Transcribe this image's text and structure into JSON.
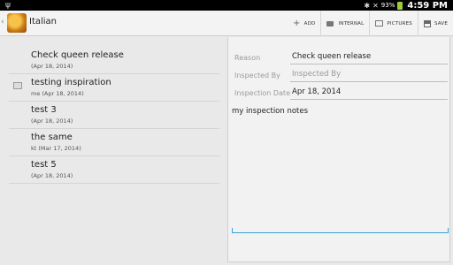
{
  "status_bar": {
    "usb_icon": "usb-icon",
    "battery_percent": "93%",
    "time": "4:59 PM",
    "battery_color": "#9ccc3c"
  },
  "action_bar": {
    "title": "Italian",
    "actions": [
      {
        "label": "ADD",
        "icon": "plus-icon"
      },
      {
        "label": "INTERNAL",
        "icon": "folder-icon"
      },
      {
        "label": "PICTURES",
        "icon": "pictures-icon"
      },
      {
        "label": "SAVE",
        "icon": "save-icon"
      }
    ]
  },
  "inspections": [
    {
      "title": "Check queen release",
      "sub": "(Apr 18, 2014)",
      "has_thumb": false
    },
    {
      "title": "testing inspiration",
      "sub": "me (Apr 18, 2014)",
      "has_thumb": true
    },
    {
      "title": "test 3",
      "sub": "(Apr 18, 2014)",
      "has_thumb": false
    },
    {
      "title": "the same",
      "sub": "kt (Mar 17, 2014)",
      "has_thumb": false
    },
    {
      "title": "test 5",
      "sub": "(Apr 18, 2014)",
      "has_thumb": false
    }
  ],
  "detail": {
    "reason_label": "Reason",
    "reason_value": "Check queen release",
    "inspected_by_label": "Inspected By",
    "inspected_by_placeholder": "Inspected By",
    "inspection_date_label": "Inspection Date",
    "inspection_date_value": "Apr 18, 2014",
    "notes": "my inspection notes",
    "accent": "#3ba0d6"
  }
}
